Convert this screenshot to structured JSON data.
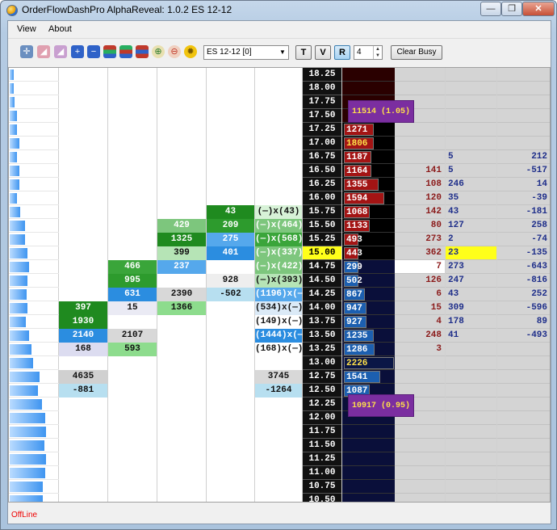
{
  "window": {
    "title": "OrderFlowDashPro AlphaReveal:  1.0.2 ES 12-12",
    "min": "—",
    "max": "❐",
    "close": "✕"
  },
  "menu": {
    "items": [
      "View",
      "About"
    ]
  },
  "toolbar": {
    "icons": [
      "crosshair-icon",
      "eraser-icon",
      "eraser-alt-icon",
      "add-icon",
      "remove-icon",
      "chart-bars-icon",
      "chart-bars-alt-icon",
      "chart-bars-red-icon",
      "zoom-in-icon",
      "zoom-out-icon",
      "settings-gear-icon"
    ],
    "symbol": "ES 12-12 [0]",
    "btn_t": "T",
    "btn_v": "V",
    "btn_r": "R",
    "ticks": "4",
    "clear_busy": "Clear Busy"
  },
  "ladder": {
    "prices": [
      "18.25",
      "18.00",
      "17.75",
      "17.50",
      "17.25",
      "17.00",
      "16.75",
      "16.50",
      "16.25",
      "16.00",
      "15.75",
      "15.50",
      "15.25",
      "15.00",
      "14.75",
      "14.50",
      "14.25",
      "14.00",
      "13.75",
      "13.50",
      "13.25",
      "13.00",
      "12.75",
      "12.50",
      "12.25",
      "12.00",
      "11.75",
      "11.50",
      "11.25",
      "11.00",
      "10.75",
      "10.50"
    ],
    "last_price": "15.00",
    "ask_tag": "11514 (1.05)",
    "bid_tag": "10917 (0.95)",
    "volume_profile": [
      0.09,
      0.09,
      0.11,
      0.16,
      0.16,
      0.2,
      0.16,
      0.2,
      0.2,
      0.16,
      0.23,
      0.32,
      0.32,
      0.38,
      0.42,
      0.38,
      0.36,
      0.38,
      0.34,
      0.42,
      0.47,
      0.5,
      0.64,
      0.6,
      0.69,
      0.76,
      0.78,
      0.74,
      0.78,
      0.76,
      0.7,
      0.7
    ],
    "volume_rows": [
      {
        "row": 4,
        "value": "1271",
        "level": 0.6,
        "color": "#a31414",
        "text": "#fff"
      },
      {
        "row": 5,
        "value": "1806",
        "level": 0.6,
        "color": "#a31414",
        "text": "#ffe14a"
      },
      {
        "row": 6,
        "value": "1187",
        "level": 0.55,
        "color": "#a31414",
        "text": "#fff"
      },
      {
        "row": 7,
        "value": "1164",
        "level": 0.55,
        "color": "#a31414",
        "text": "#fff"
      },
      {
        "row": 8,
        "value": "1355",
        "level": 0.7,
        "color": "#a31414",
        "text": "#fff"
      },
      {
        "row": 9,
        "value": "1594",
        "level": 0.8,
        "color": "#a31414",
        "text": "#fff"
      },
      {
        "row": 10,
        "value": "1068",
        "level": 0.52,
        "color": "#a31414",
        "text": "#fff"
      },
      {
        "row": 11,
        "value": "1133",
        "level": 0.52,
        "color": "#a31414",
        "text": "#fff"
      },
      {
        "row": 12,
        "value": "493",
        "level": 0.22,
        "color": "#a31414",
        "text": "#fff"
      },
      {
        "row": 13,
        "value": "443",
        "level": 0.18,
        "color": "#a31414",
        "text": "#fff"
      },
      {
        "row": 14,
        "value": "299",
        "level": 0.15,
        "color": "#1c5fb0",
        "text": "#fff"
      },
      {
        "row": 15,
        "value": "502",
        "level": 0.25,
        "color": "#1c5fb0",
        "text": "#fff"
      },
      {
        "row": 16,
        "value": "867",
        "level": 0.42,
        "color": "#1c5fb0",
        "text": "#fff"
      },
      {
        "row": 17,
        "value": "947",
        "level": 0.45,
        "color": "#1c5fb0",
        "text": "#fff"
      },
      {
        "row": 18,
        "value": "927",
        "level": 0.45,
        "color": "#1c5fb0",
        "text": "#fff"
      },
      {
        "row": 19,
        "value": "1235",
        "level": 0.6,
        "color": "#1c5fb0",
        "text": "#fff"
      },
      {
        "row": 20,
        "value": "1286",
        "level": 0.62,
        "color": "#1c5fb0",
        "text": "#fff"
      },
      {
        "row": 21,
        "value": "2226",
        "level": 1.0,
        "color": "#0a1646",
        "text": "#ffe14a"
      },
      {
        "row": 22,
        "value": "1541",
        "level": 0.72,
        "color": "#1c5fb0",
        "text": "#fff"
      },
      {
        "row": 23,
        "value": "1087",
        "level": 0.52,
        "color": "#1c5fb0",
        "text": "#fff"
      }
    ],
    "trade_cols": [
      {
        "col": 1,
        "row": 17,
        "value": "397",
        "bg": "#1f8a1f",
        "fg": "#fff"
      },
      {
        "col": 1,
        "row": 18,
        "value": "1930",
        "bg": "#1f8a1f",
        "fg": "#fff"
      },
      {
        "col": 1,
        "row": 19,
        "value": "2140",
        "bg": "#2b8de0",
        "fg": "#fff"
      },
      {
        "col": 1,
        "row": 20,
        "value": "168",
        "bg": "#dcdcf0",
        "fg": "#111"
      },
      {
        "col": 1,
        "row": 22,
        "value": "4635",
        "bg": "#d0d0d0",
        "fg": "#111"
      },
      {
        "col": 1,
        "row": 23,
        "value": "-881",
        "bg": "#b7dff0",
        "fg": "#111"
      },
      {
        "col": 2,
        "row": 14,
        "value": "466",
        "bg": "#3aa53a",
        "fg": "#fff"
      },
      {
        "col": 2,
        "row": 15,
        "value": "995",
        "bg": "#2d9b2d",
        "fg": "#fff"
      },
      {
        "col": 2,
        "row": 16,
        "value": "631",
        "bg": "#2b8de0",
        "fg": "#fff"
      },
      {
        "col": 2,
        "row": 17,
        "value": "15",
        "bg": "#eaeaf4",
        "fg": "#111"
      },
      {
        "col": 2,
        "row": 19,
        "value": "2107",
        "bg": "#d8d8d8",
        "fg": "#111"
      },
      {
        "col": 2,
        "row": 20,
        "value": "593",
        "bg": "#8ddc8d",
        "fg": "#111"
      },
      {
        "col": 3,
        "row": 11,
        "value": "429",
        "bg": "#7dc67d",
        "fg": "#fff"
      },
      {
        "col": 3,
        "row": 12,
        "value": "1325",
        "bg": "#1f8a1f",
        "fg": "#fff"
      },
      {
        "col": 3,
        "row": 13,
        "value": "399",
        "bg": "#b6e4b6",
        "fg": "#111"
      },
      {
        "col": 3,
        "row": 14,
        "value": "237",
        "bg": "#55a8ec",
        "fg": "#fff"
      },
      {
        "col": 3,
        "row": 16,
        "value": "2390",
        "bg": "#d8d8d8",
        "fg": "#111"
      },
      {
        "col": 3,
        "row": 17,
        "value": "1366",
        "bg": "#8ddc8d",
        "fg": "#111"
      },
      {
        "col": 4,
        "row": 10,
        "value": "43",
        "bg": "#1f8a1f",
        "fg": "#fff"
      },
      {
        "col": 4,
        "row": 11,
        "value": "209",
        "bg": "#2d9b2d",
        "fg": "#fff"
      },
      {
        "col": 4,
        "row": 12,
        "value": "275",
        "bg": "#55a8ec",
        "fg": "#fff"
      },
      {
        "col": 4,
        "row": 13,
        "value": "401",
        "bg": "#2b8de0",
        "fg": "#fff"
      },
      {
        "col": 4,
        "row": 15,
        "value": "928",
        "bg": "#eeeeee",
        "fg": "#111"
      },
      {
        "col": 4,
        "row": 16,
        "value": "-502",
        "bg": "#b7dff0",
        "fg": "#111"
      },
      {
        "col": 5,
        "row": 10,
        "value": "(—)x(43)",
        "bg": "#d7f2d7",
        "fg": "#111"
      },
      {
        "col": 5,
        "row": 11,
        "value": "(—)x(464)",
        "bg": "#7dc67d",
        "fg": "#fff"
      },
      {
        "col": 5,
        "row": 12,
        "value": "(—)x(568)",
        "bg": "#3aa53a",
        "fg": "#fff"
      },
      {
        "col": 5,
        "row": 13,
        "value": "(—)x(337)",
        "bg": "#7dc67d",
        "fg": "#fff"
      },
      {
        "col": 5,
        "row": 14,
        "value": "(—)x(422)",
        "bg": "#7dc67d",
        "fg": "#fff"
      },
      {
        "col": 5,
        "row": 15,
        "value": "(—)x(393)",
        "bg": "#b6e4b6",
        "fg": "#111"
      },
      {
        "col": 5,
        "row": 16,
        "value": "(1196)x(—",
        "bg": "#55a8ec",
        "fg": "#fff"
      },
      {
        "col": 5,
        "row": 17,
        "value": "(534)x(—)",
        "bg": "#dbeaf7",
        "fg": "#111"
      },
      {
        "col": 5,
        "row": 18,
        "value": "(149)x(—)",
        "bg": "#ffffff",
        "fg": "#111"
      },
      {
        "col": 5,
        "row": 19,
        "value": "(1444)x(—",
        "bg": "#2b8de0",
        "fg": "#fff"
      },
      {
        "col": 5,
        "row": 20,
        "value": "(168)x(—)",
        "bg": "#ffffff",
        "fg": "#111"
      },
      {
        "col": 5,
        "row": 22,
        "value": "3745",
        "bg": "#d8d8d8",
        "fg": "#111"
      },
      {
        "col": 5,
        "row": 23,
        "value": "-1264",
        "bg": "#b7dff0",
        "fg": "#111"
      }
    ],
    "right_a": [
      {
        "row": 7,
        "value": "141"
      },
      {
        "row": 8,
        "value": "108"
      },
      {
        "row": 9,
        "value": "120"
      },
      {
        "row": 10,
        "value": "142"
      },
      {
        "row": 11,
        "value": "80"
      },
      {
        "row": 12,
        "value": "273"
      },
      {
        "row": 13,
        "value": "362"
      },
      {
        "row": 14,
        "value": "7"
      },
      {
        "row": 15,
        "value": "126"
      },
      {
        "row": 16,
        "value": "6"
      },
      {
        "row": 17,
        "value": "15"
      },
      {
        "row": 18,
        "value": "4"
      },
      {
        "row": 19,
        "value": "248"
      },
      {
        "row": 20,
        "value": "3"
      }
    ],
    "right_b": [
      {
        "row": 6,
        "value": "5"
      },
      {
        "row": 7,
        "value": "5"
      },
      {
        "row": 8,
        "value": "246"
      },
      {
        "row": 9,
        "value": "35"
      },
      {
        "row": 10,
        "value": "43"
      },
      {
        "row": 11,
        "value": "127"
      },
      {
        "row": 12,
        "value": "2"
      },
      {
        "row": 13,
        "value": "23"
      },
      {
        "row": 14,
        "value": "273"
      },
      {
        "row": 15,
        "value": "247"
      },
      {
        "row": 16,
        "value": "43"
      },
      {
        "row": 17,
        "value": "309"
      },
      {
        "row": 18,
        "value": "178"
      },
      {
        "row": 19,
        "value": "41"
      }
    ],
    "right_c": [
      {
        "row": 6,
        "value": "212"
      },
      {
        "row": 7,
        "value": "-517"
      },
      {
        "row": 8,
        "value": "14"
      },
      {
        "row": 9,
        "value": "-39"
      },
      {
        "row": 10,
        "value": "-181"
      },
      {
        "row": 11,
        "value": "258"
      },
      {
        "row": 12,
        "value": "-74"
      },
      {
        "row": 13,
        "value": "-135"
      },
      {
        "row": 14,
        "value": "-643"
      },
      {
        "row": 15,
        "value": "-816"
      },
      {
        "row": 16,
        "value": "252"
      },
      {
        "row": 17,
        "value": "-596"
      },
      {
        "row": 18,
        "value": "89"
      },
      {
        "row": 19,
        "value": "-493"
      }
    ]
  },
  "status": {
    "text": "OffLine"
  }
}
